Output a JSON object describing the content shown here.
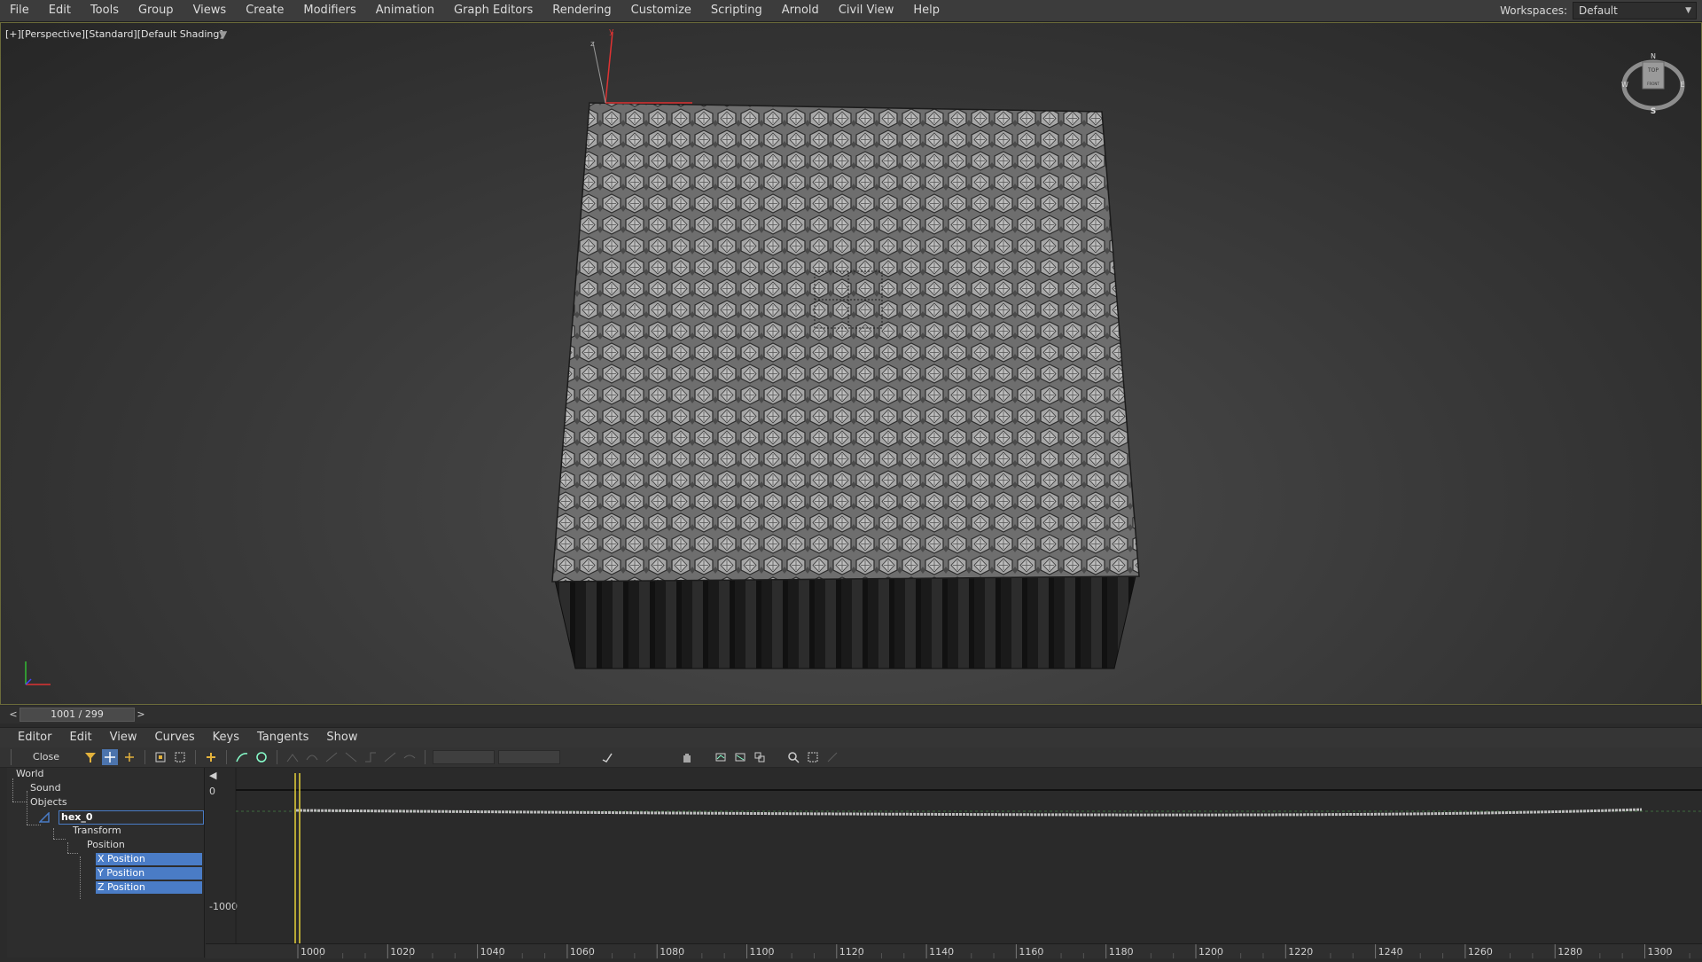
{
  "menu": [
    "File",
    "Edit",
    "Tools",
    "Group",
    "Views",
    "Create",
    "Modifiers",
    "Animation",
    "Graph Editors",
    "Rendering",
    "Customize",
    "Scripting",
    "Arnold",
    "Civil View",
    "Help"
  ],
  "workspace": {
    "label": "Workspaces:",
    "value": "Default"
  },
  "viewport": {
    "label": "[+][Perspective][Standard][Default Shading]",
    "gizmo_axes": [
      "z",
      "y"
    ],
    "viewcube": {
      "top": "TOP",
      "front": "FRONT",
      "n": "N",
      "e": "E",
      "s": "S",
      "w": "W"
    }
  },
  "timeline": {
    "prev": "<",
    "next": ">",
    "value": "1001 / 299"
  },
  "curve_editor": {
    "menu": [
      "Editor",
      "Edit",
      "View",
      "Curves",
      "Keys",
      "Tangents",
      "Show"
    ],
    "close_label": "Close",
    "tree": {
      "world": "World",
      "sound": "Sound",
      "objects": "Objects",
      "object": "hex_0",
      "transform": "Transform",
      "position": "Position",
      "x": "X Position",
      "y": "Y Position",
      "z": "Z Position"
    },
    "y_ticks": [
      "0",
      "-1000"
    ],
    "x_ticks": [
      "1000",
      "1020",
      "1040",
      "1060",
      "1080",
      "1100",
      "1120",
      "1140",
      "1160",
      "1180",
      "1200",
      "1220",
      "1240",
      "1260",
      "1280",
      "1300"
    ],
    "current_frame": 1000
  },
  "colors": {
    "accent": "#4a7cc6",
    "time_slider": "#e6d23a",
    "viewport_border": "#6b6b3a"
  }
}
